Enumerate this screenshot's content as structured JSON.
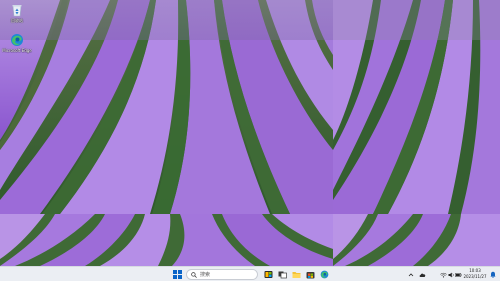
{
  "desktop": {
    "icons": [
      {
        "name": "recycle-bin",
        "label": "回收站"
      },
      {
        "name": "microsoft-edge",
        "label": "Microsoft Edge"
      }
    ]
  },
  "taskbar": {
    "search_placeholder": "搜索",
    "pinned": [
      "start",
      "search",
      "file-explorer-copy",
      "task-view",
      "file-explorer",
      "microsoft-store",
      "edge"
    ],
    "tray_icons": [
      "chevron-up",
      "cloud",
      "network",
      "volume",
      "battery"
    ],
    "clock": {
      "time": "10:03",
      "date": "2023/11/27"
    }
  },
  "colors": {
    "lavender": "#9d6fd6",
    "lavender_light": "#c9a6ee",
    "field_green": "#3f6b37",
    "taskbar_bg": "#ebeef3",
    "accent": "#0078d4"
  }
}
